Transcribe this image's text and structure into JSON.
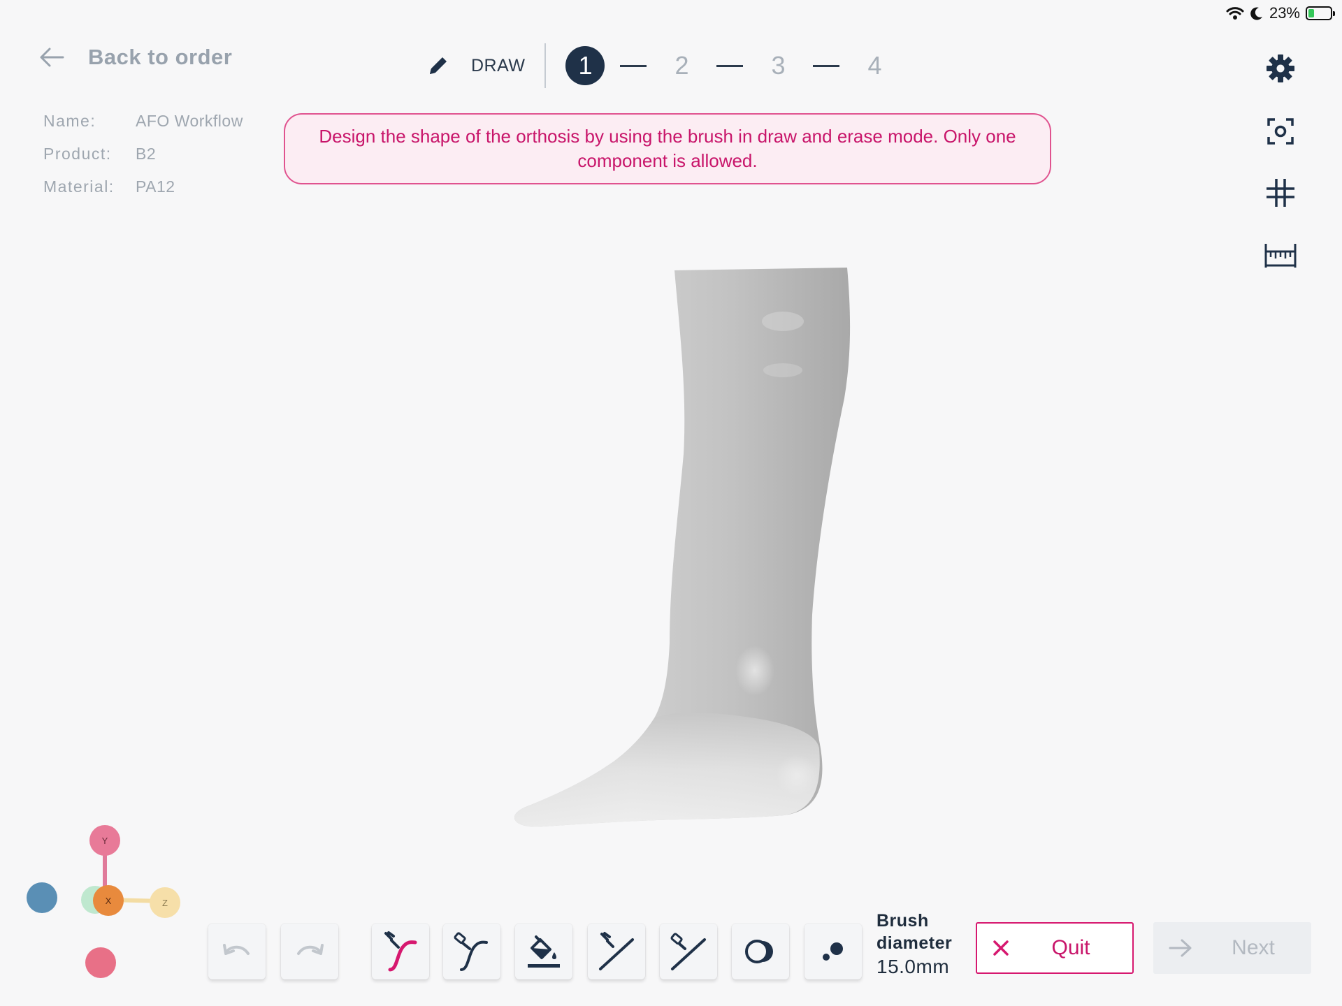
{
  "status_bar": {
    "battery": "23%",
    "battery_level": 0.23,
    "icons": [
      "wifi-icon",
      "moon-icon",
      "battery-icon"
    ]
  },
  "header": {
    "back_label": "Back to order"
  },
  "order": {
    "name_label": "Name:",
    "name_value": "AFO Workflow",
    "product_label": "Product:",
    "product_value": "B2",
    "material_label": "Material:",
    "material_value": "PA12"
  },
  "stepper": {
    "mode": "DRAW",
    "steps": [
      "1",
      "2",
      "3",
      "4"
    ],
    "active_step": "1"
  },
  "banner": {
    "text": "Design the shape of the orthosis by using the brush in draw and erase mode. Only one component is allowed."
  },
  "side_tools": [
    "gear-icon",
    "screenshot-icon",
    "grid-icon",
    "ruler-icon"
  ],
  "gizmo": {
    "y": "Y",
    "x": "X",
    "z": "Z"
  },
  "toolbar": {
    "tools": [
      "undo-icon",
      "redo-icon",
      "draw-curve-icon",
      "erase-curve-icon",
      "fill-icon",
      "draw-line-icon",
      "erase-line-icon",
      "toggle-view-icon",
      "points-icon"
    ],
    "brush_label_1": "Brush",
    "brush_label_2": "diameter",
    "brush_value": "15.0mm",
    "quit_label": "Quit",
    "next_label": "Next"
  },
  "colors": {
    "accent": "#d6186f",
    "navy": "#1f3148",
    "banner_bg": "#fcedf3"
  }
}
